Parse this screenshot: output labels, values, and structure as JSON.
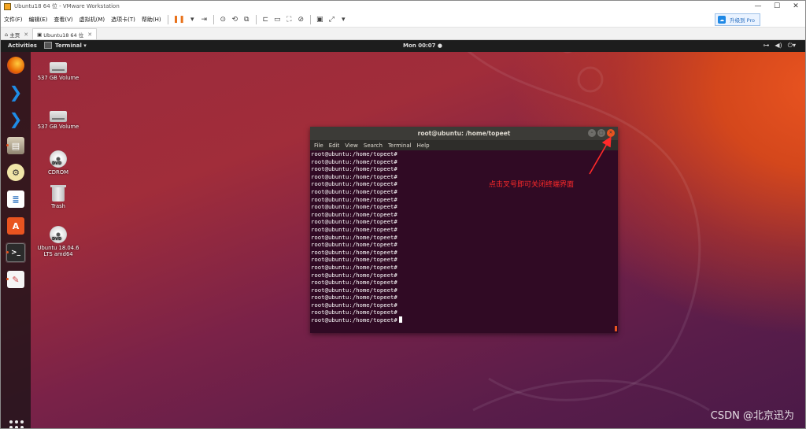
{
  "window": {
    "title": "Ubuntu18 64 位 - VMware Workstation"
  },
  "menubar": {
    "items": [
      "文件(F)",
      "编辑(E)",
      "查看(V)",
      "虚拟机(M)",
      "选项卡(T)",
      "帮助(H)"
    ],
    "upgrade_label": "升级到 Pro",
    "upgrade_icon": "cloud-icon"
  },
  "tabs": [
    {
      "label": "主页"
    },
    {
      "label": "Ubuntu18 64 位"
    }
  ],
  "ubuntu": {
    "topbar": {
      "activities": "Activities",
      "app_menu": "Terminal ▾",
      "clock": "Mon 00:07 ●"
    },
    "dock": [
      {
        "name": "firefox",
        "color": "#e66000"
      },
      {
        "name": "vscode",
        "color": "#1f7bd4"
      },
      {
        "name": "vscode-2",
        "color": "#1f7bd4"
      },
      {
        "name": "files",
        "color": "#9a8f7a"
      },
      {
        "name": "software-settings",
        "color": "#444444"
      },
      {
        "name": "libreoffice-writer",
        "color": "#2a6fbf"
      },
      {
        "name": "ubuntu-software",
        "color": "#e95420"
      },
      {
        "name": "terminal",
        "color": "#2b2b2b"
      },
      {
        "name": "text-editor",
        "color": "#dddddd"
      }
    ],
    "desktop": [
      {
        "label": "537 GB Volume",
        "kind": "drive"
      },
      {
        "label": "537 GB Volume",
        "kind": "drive"
      },
      {
        "label": "CDROM",
        "kind": "disc"
      },
      {
        "label": "Trash",
        "kind": "trash"
      },
      {
        "label": "Ubuntu 18.04.6 LTS amd64",
        "kind": "disc"
      }
    ]
  },
  "terminal": {
    "title": "root@ubuntu: /home/topeet",
    "menu": [
      "File",
      "Edit",
      "View",
      "Search",
      "Terminal",
      "Help"
    ],
    "lines": [
      "root@ubuntu:/home/topeet#",
      "root@ubuntu:/home/topeet#",
      "root@ubuntu:/home/topeet#",
      "root@ubuntu:/home/topeet#",
      "root@ubuntu:/home/topeet#",
      "root@ubuntu:/home/topeet#",
      "root@ubuntu:/home/topeet#",
      "root@ubuntu:/home/topeet#",
      "root@ubuntu:/home/topeet#",
      "root@ubuntu:/home/topeet#",
      "root@ubuntu:/home/topeet#",
      "root@ubuntu:/home/topeet#",
      "root@ubuntu:/home/topeet#",
      "root@ubuntu:/home/topeet#",
      "root@ubuntu:/home/topeet#",
      "root@ubuntu:/home/topeet#",
      "root@ubuntu:/home/topeet#",
      "root@ubuntu:/home/topeet#",
      "root@ubuntu:/home/topeet#",
      "root@ubuntu:/home/topeet#",
      "root@ubuntu:/home/topeet#",
      "root@ubuntu:/home/topeet#",
      "root@ubuntu:/home/topeet#"
    ]
  },
  "annotation": {
    "text": "点击叉号即可关闭终端界面",
    "color": "#ff2a2a"
  },
  "watermark": "CSDN @北京迅为"
}
